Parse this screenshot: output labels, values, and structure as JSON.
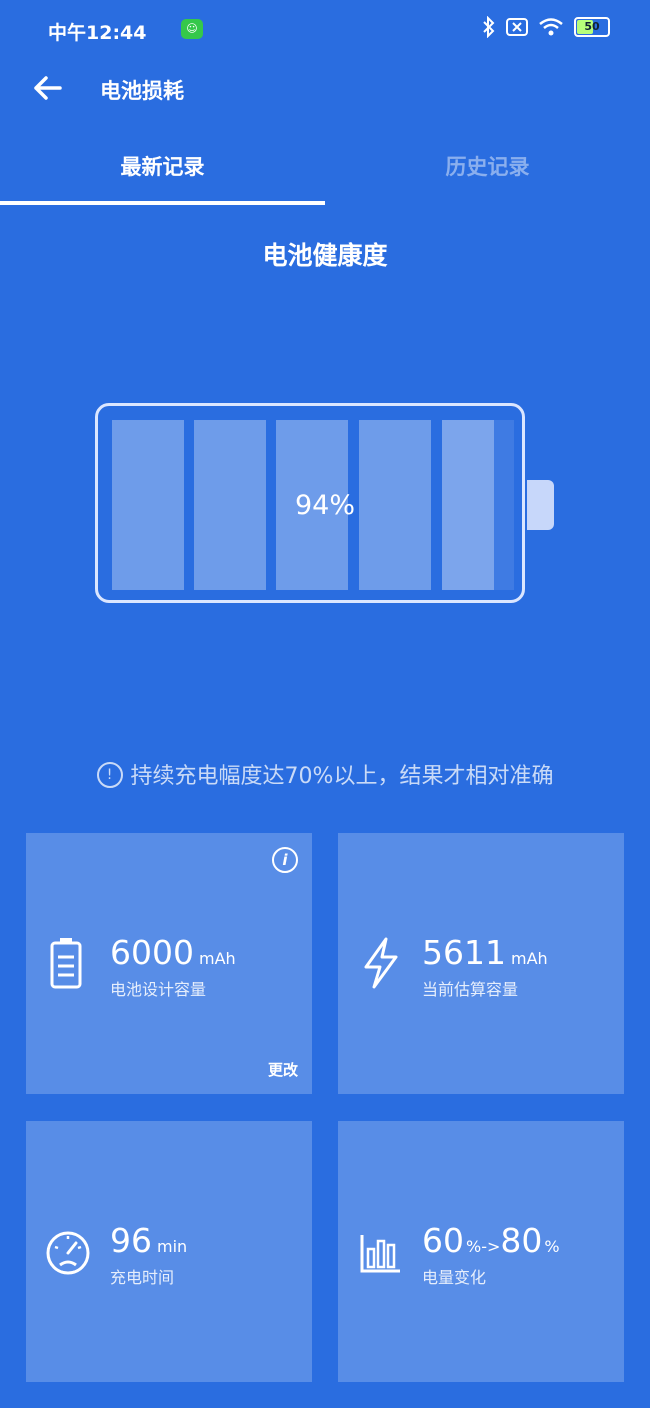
{
  "status_bar": {
    "time": "中午12:44",
    "battery_level": "50"
  },
  "header": {
    "title": "电池损耗"
  },
  "tabs": [
    {
      "label": "最新记录",
      "active": true
    },
    {
      "label": "历史记录",
      "active": false
    }
  ],
  "health": {
    "title": "电池健康度",
    "percent": "94%"
  },
  "notice": "持续充电幅度达70%以上，结果才相对准确",
  "cards": [
    {
      "value": "6000",
      "unit": "mAh",
      "label": "电池设计容量",
      "action": "更改",
      "icon": "battery-icon"
    },
    {
      "value": "5611",
      "unit": "mAh",
      "label": "当前估算容量",
      "icon": "lightning-icon"
    },
    {
      "value": "96",
      "unit": "min",
      "label": "充电时间",
      "icon": "speedometer-icon"
    },
    {
      "value_start": "60",
      "value_end": "80",
      "unit": "%",
      "arrow": "->",
      "label": "电量变化",
      "icon": "bar-chart-icon"
    }
  ],
  "colors": {
    "background": "#2a6de0",
    "card": "#5690e8"
  }
}
